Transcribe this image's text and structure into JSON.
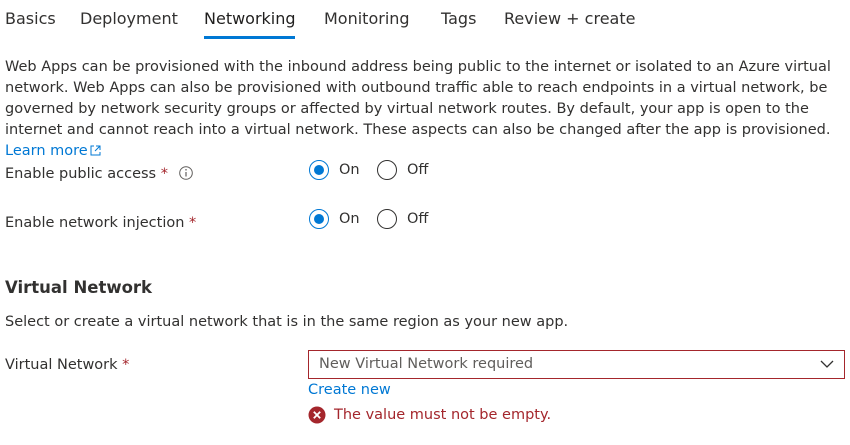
{
  "tabs": [
    {
      "label": "Basics"
    },
    {
      "label": "Deployment"
    },
    {
      "label": "Networking",
      "active": true
    },
    {
      "label": "Monitoring"
    },
    {
      "label": "Tags"
    },
    {
      "label": "Review + create"
    }
  ],
  "intro": {
    "text": "Web Apps can be provisioned with the inbound address being public to the internet or isolated to an Azure virtual network. Web Apps can also be provisioned with outbound traffic able to reach endpoints in a virtual network, be governed by network security groups or affected by virtual network routes. By default, your app is open to the internet and cannot reach into a virtual network. These aspects can also be changed after the app is provisioned.",
    "learn_more": "Learn more"
  },
  "public_access": {
    "label": "Enable public access",
    "required": "*",
    "on_label": "On",
    "off_label": "Off",
    "selected": "On"
  },
  "network_injection": {
    "label": "Enable network injection",
    "required": "*",
    "on_label": "On",
    "off_label": "Off",
    "selected": "On"
  },
  "virtual_network_section": {
    "title": "Virtual Network",
    "description": "Select or create a virtual network that is in the same region as your new app."
  },
  "virtual_network_field": {
    "label": "Virtual Network",
    "required": "*",
    "placeholder": "New Virtual Network required",
    "create_new": "Create new",
    "error": "The value must not be empty."
  },
  "colors": {
    "accent": "#0078d4",
    "error": "#a4262c",
    "text": "#323130"
  }
}
